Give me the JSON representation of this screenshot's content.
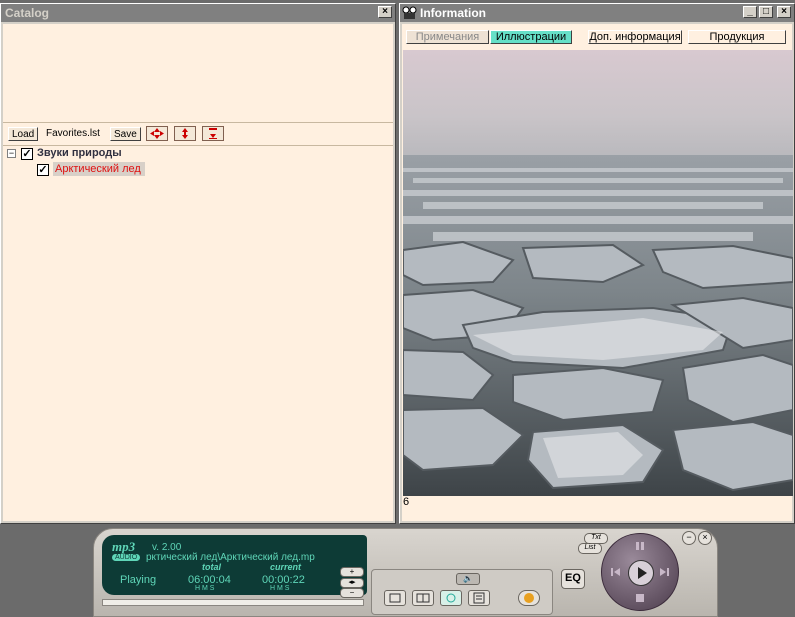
{
  "catalog": {
    "title": "Catalog",
    "close_glyph": "×",
    "toolbar": {
      "load": "Load",
      "list_name": "Favorites.lst",
      "save": "Save"
    },
    "tree": {
      "group_label": "Звуки природы",
      "item_label": "Арктический лед"
    }
  },
  "info": {
    "title": "Information",
    "tabs": [
      {
        "label": "Примечания"
      },
      {
        "label": "Иллюстрации"
      },
      {
        "label": "Доп. информация"
      },
      {
        "label": "Продукция"
      }
    ],
    "active_tab": "Иллюстрации",
    "page_number": "6"
  },
  "player": {
    "logo": "mp3",
    "logo_sub": "AUDIO",
    "version": "v. 2.00",
    "track_path": "рктический лед\\Арктический лед.mp",
    "status": "Playing",
    "total_label": "total",
    "current_label": "current",
    "total_time": "06:00:04",
    "current_time": "00:00:22",
    "hms": "H  M  S",
    "eq_label": "EQ",
    "txt_label": "Txt",
    "list_label": "List"
  },
  "colors": {
    "accent_tab": "#66e0c8",
    "item_text": "#e01010",
    "lcd_bg": "#0d3b36"
  }
}
